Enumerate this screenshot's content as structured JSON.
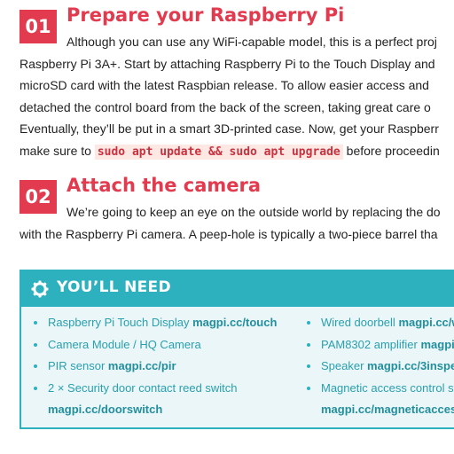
{
  "step1": {
    "number": "01",
    "title": "Prepare your Raspberry Pi",
    "lines": [
      "Although you can use any WiFi-capable model, this is a perfect proj",
      "Raspberry Pi 3A+. Start by attaching Raspberry Pi to the Touch Display and",
      "microSD card with the latest Raspbian release. To allow easier access and",
      "detached the control board from the back of the screen, taking great care o",
      "Eventually, they’ll be put in a smart 3D-printed case. Now, get your Raspberr"
    ],
    "last_line_before": "make sure to ",
    "last_line_code": "sudo apt update && sudo apt upgrade",
    "last_line_after": " before proceedin"
  },
  "step2": {
    "number": "02",
    "title": "Attach the camera",
    "lines": [
      "We’re going to keep an eye on the outside world by replacing the do",
      "with the Raspberry Pi camera. A peep-hole is typically a two-piece barrel tha"
    ]
  },
  "you_need": {
    "title": "YOU’LL NEED",
    "icon": "gear-icon",
    "colors": {
      "accent": "#2db1bf",
      "panel": "#eaf6f8",
      "text": "#2a9fae"
    },
    "left_items": [
      {
        "label": "Raspberry Pi Touch Display ",
        "url": "magpi.cc/touch"
      },
      {
        "label": "Camera Module / HQ Camera",
        "url": ""
      },
      {
        "label": "PIR sensor ",
        "url": "magpi.cc/pir"
      },
      {
        "label": "2 × Security door contact reed switch",
        "url": ""
      },
      {
        "label": "",
        "url": "magpi.cc/doorswitch"
      }
    ],
    "right_items": [
      {
        "label": "Wired doorbell ",
        "url": "magpi.cc/w"
      },
      {
        "label": "PAM8302 amplifier ",
        "url": "magpi."
      },
      {
        "label": "Speaker ",
        "url": "magpi.cc/3inspea"
      },
      {
        "label": "Magnetic access control sy",
        "url": ""
      },
      {
        "label": "",
        "url": "magpi.cc/magneticaccess"
      }
    ]
  }
}
